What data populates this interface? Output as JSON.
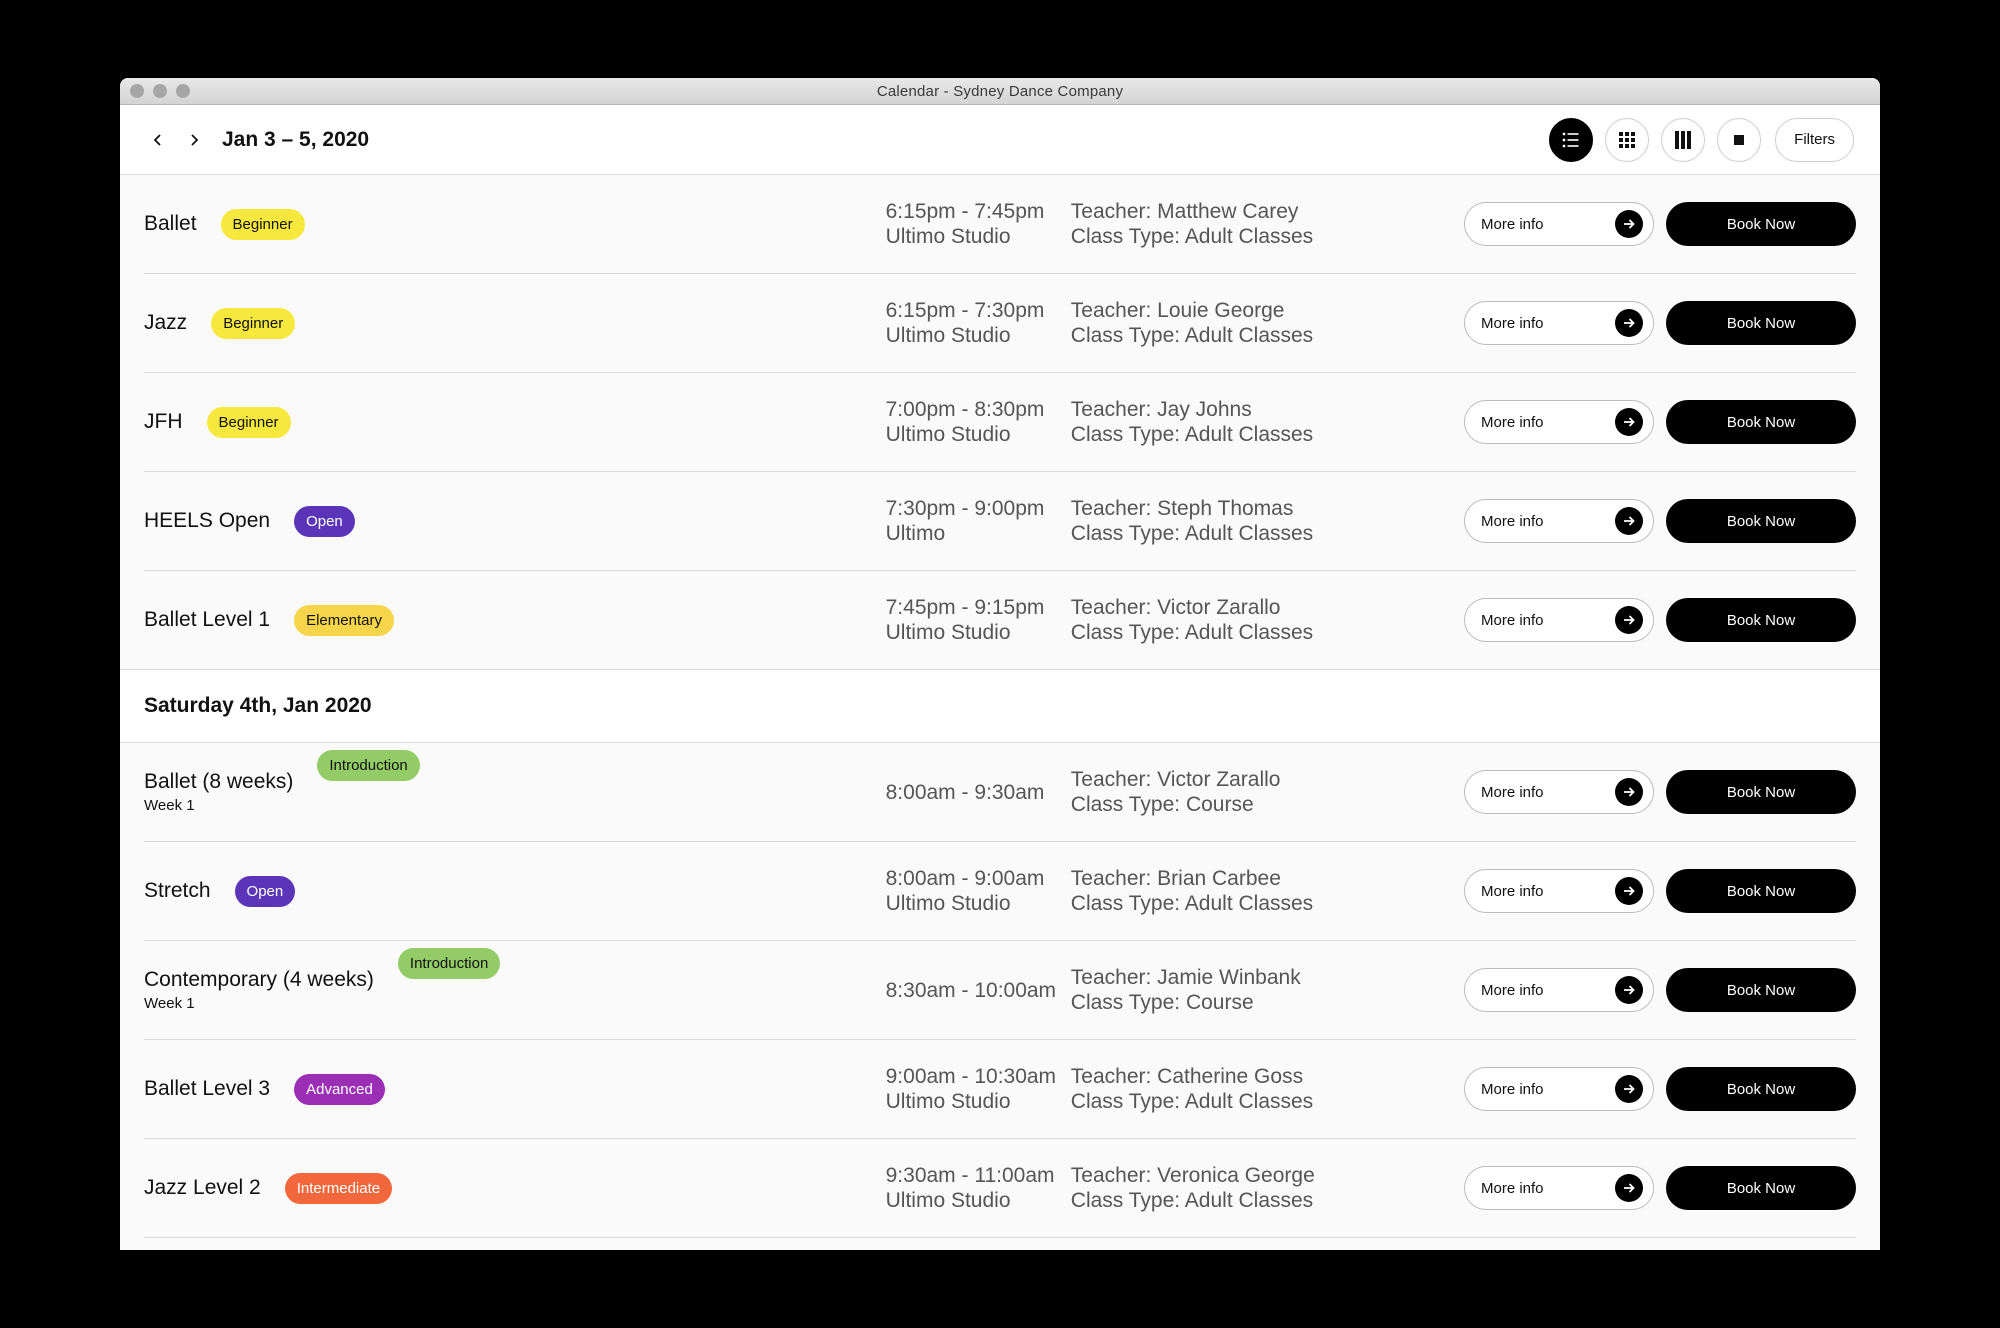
{
  "window": {
    "title": "Calendar - Sydney Dance Company"
  },
  "toolbar": {
    "date_range": "Jan 3 – 5, 2020",
    "filters_label": "Filters",
    "views": [
      "list-view-icon",
      "grid-view-icon",
      "columns-view-icon",
      "single-view-icon"
    ],
    "active_view": "list"
  },
  "labels": {
    "more_info": "More info",
    "book_now": "Book Now"
  },
  "badge_colors": {
    "Beginner": "#f7e83e",
    "Open": "#5b35b8",
    "Elementary": "#f7d54a",
    "Introduction": "#93cc66",
    "Advanced": "#9a2fb5",
    "Intermediate": "#f2683c"
  },
  "friday_classes": [
    {
      "name": "Ballet",
      "level": "Beginner",
      "time": "6:15pm - 7:45pm",
      "location": "Ultimo Studio",
      "teacher": "Teacher: Matthew Carey",
      "class_type": "Class Type: Adult Classes"
    },
    {
      "name": "Jazz",
      "level": "Beginner",
      "time": "6:15pm - 7:30pm",
      "location": "Ultimo Studio",
      "teacher": "Teacher: Louie George",
      "class_type": "Class Type: Adult Classes"
    },
    {
      "name": "JFH",
      "level": "Beginner",
      "time": "7:00pm - 8:30pm",
      "location": "Ultimo Studio",
      "teacher": "Teacher: Jay Johns",
      "class_type": "Class Type: Adult Classes"
    },
    {
      "name": "HEELS Open",
      "level": "Open",
      "time": "7:30pm - 9:00pm",
      "location": "Ultimo",
      "teacher": "Teacher: Steph Thomas",
      "class_type": "Class Type: Adult Classes"
    },
    {
      "name": "Ballet Level 1",
      "level": "Elementary",
      "time": "7:45pm - 9:15pm",
      "location": "Ultimo Studio",
      "teacher": "Teacher: Victor Zarallo",
      "class_type": "Class Type: Adult Classes"
    }
  ],
  "saturday_header": "Saturday 4th, Jan 2020",
  "saturday_classes": [
    {
      "name": "Ballet (8 weeks)",
      "sub": "Week 1",
      "level": "Introduction",
      "time": "8:00am - 9:30am",
      "location": "",
      "teacher": "Teacher: Victor Zarallo",
      "class_type": "Class Type: Course"
    },
    {
      "name": "Stretch",
      "level": "Open",
      "time": "8:00am - 9:00am",
      "location": "Ultimo Studio",
      "teacher": "Teacher: Brian Carbee",
      "class_type": "Class Type: Adult Classes"
    },
    {
      "name": "Contemporary (4 weeks)",
      "sub": "Week 1",
      "level": "Introduction",
      "time": "8:30am - 10:00am",
      "location": "",
      "teacher": "Teacher: Jamie Winbank",
      "class_type": "Class Type: Course"
    },
    {
      "name": "Ballet Level 3",
      "level": "Advanced",
      "time": "9:00am - 10:30am",
      "location": "Ultimo Studio",
      "teacher": "Teacher: Catherine Goss",
      "class_type": "Class Type: Adult Classes"
    },
    {
      "name": "Jazz Level 2",
      "level": "Intermediate",
      "time": "9:30am - 11:00am",
      "location": "Ultimo Studio",
      "teacher": "Teacher: Veronica George",
      "class_type": "Class Type: Adult Classes"
    }
  ]
}
